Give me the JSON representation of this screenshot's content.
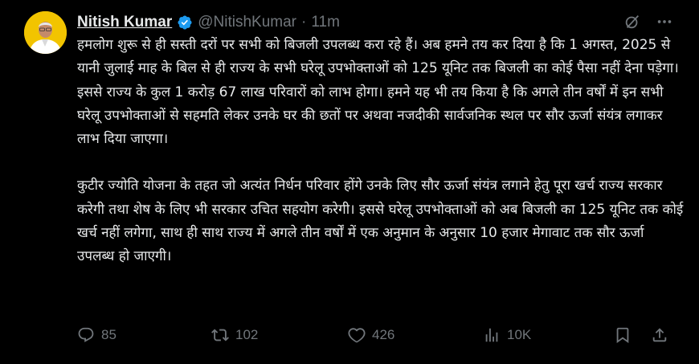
{
  "tweet": {
    "author": {
      "name": "Nitish Kumar",
      "handle": "@NitishKumar",
      "separator": "·",
      "time": "11m"
    },
    "paragraphs": [
      "हमलोग शुरू से ही सस्ती दरों पर सभी को बिजली उपलब्ध करा रहे हैं। अब हमने तय कर दिया है कि 1 अगस्त, 2025 से यानी जुलाई माह के बिल से ही राज्य के सभी घरेलू उपभोक्ताओं को 125 यूनिट तक बिजली का कोई पैसा नहीं देना पड़ेगा। इससे राज्य के कुल 1 करोड़ 67 लाख परिवारों को लाभ होगा। हमने यह भी तय किया है कि अगले तीन वर्षों में इन सभी घरेलू उपभोक्ताओं से सहमति लेकर उनके घर की छतों पर अथवा नजदीकी सार्वजनिक स्थल पर सौर ऊर्जा संयंत्र लगाकर लाभ दिया जाएगा।",
      "कुटीर ज्योति योजना के तहत जो अत्यंत निर्धन परिवार होंगे उनके लिए सौर ऊर्जा संयंत्र लगाने हेतु पूरा खर्च राज्य सरकार करेगी तथा शेष के लिए भी सरकार उचित सहयोग करेगी। इससे घरेलू उपभोक्ताओं को अब बिजली का 125 यूनिट तक कोई खर्च नहीं लगेगा, साथ ही साथ राज्य में अगले तीन वर्षों में एक अनुमान के अनुसार 10 हजार मेगावाट तक सौर ऊर्जा उपलब्ध हो जाएगी।"
    ],
    "stats": {
      "replies": "85",
      "reposts": "102",
      "likes": "426",
      "views": "10K"
    },
    "icons": {
      "verified": "verified-badge-icon",
      "grok": "grok-icon",
      "more": "more-icon",
      "reply": "reply-icon",
      "repost": "repost-icon",
      "like": "heart-icon",
      "views": "views-icon",
      "bookmark": "bookmark-icon",
      "share": "share-icon"
    },
    "colors": {
      "background": "#000000",
      "text": "#e7e9ea",
      "muted": "#71767b",
      "verified": "#1d9bf0",
      "avatar_bg": "#f2c400"
    }
  }
}
